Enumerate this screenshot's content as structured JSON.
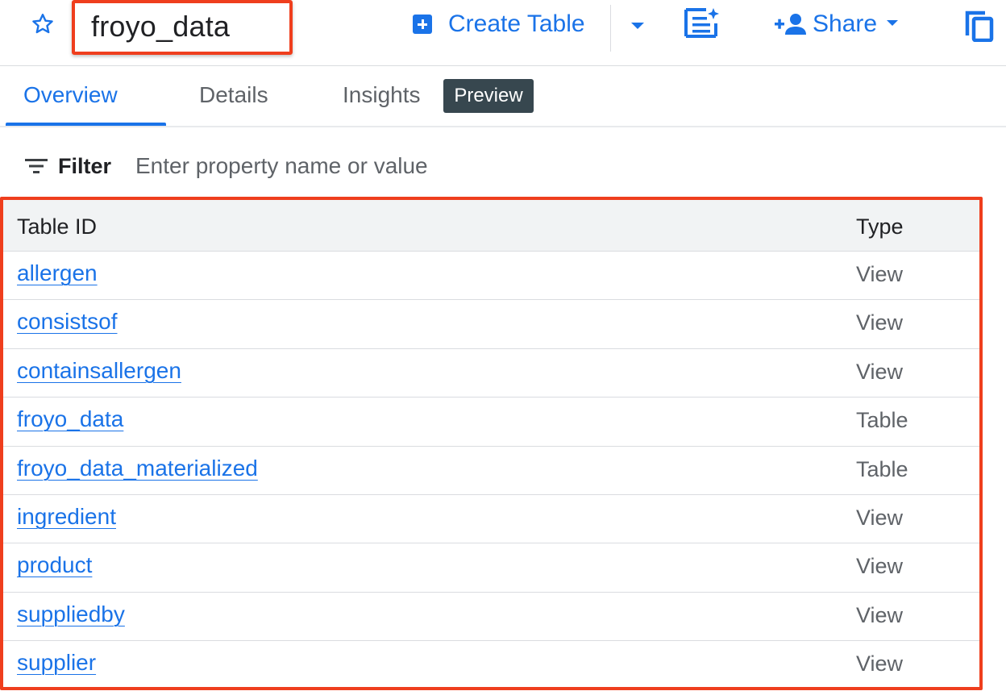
{
  "header": {
    "title": "froyo_data",
    "create_table_label": "Create Table",
    "share_label": "Share",
    "icons": [
      "star-icon",
      "add-box-icon",
      "chevron-down-icon",
      "query-icon",
      "person-add-icon",
      "copy-icon"
    ]
  },
  "tabs": [
    {
      "label": "Overview",
      "active": true
    },
    {
      "label": "Details",
      "active": false
    },
    {
      "label": "Insights",
      "active": false,
      "badge": "Preview"
    }
  ],
  "filter": {
    "label": "Filter",
    "placeholder": "Enter property name or value",
    "value": ""
  },
  "table": {
    "columns": [
      "Table ID",
      "Type"
    ],
    "rows": [
      {
        "id": "allergen",
        "type": "View"
      },
      {
        "id": "consistsof",
        "type": "View"
      },
      {
        "id": "containsallergen",
        "type": "View"
      },
      {
        "id": "froyo_data",
        "type": "Table"
      },
      {
        "id": "froyo_data_materialized",
        "type": "Table"
      },
      {
        "id": "ingredient",
        "type": "View"
      },
      {
        "id": "product",
        "type": "View"
      },
      {
        "id": "suppliedby",
        "type": "View"
      },
      {
        "id": "supplier",
        "type": "View"
      }
    ]
  },
  "colors": {
    "accent": "#1a73e8",
    "highlight": "#ef3e1d",
    "badge_bg": "#37474f"
  }
}
